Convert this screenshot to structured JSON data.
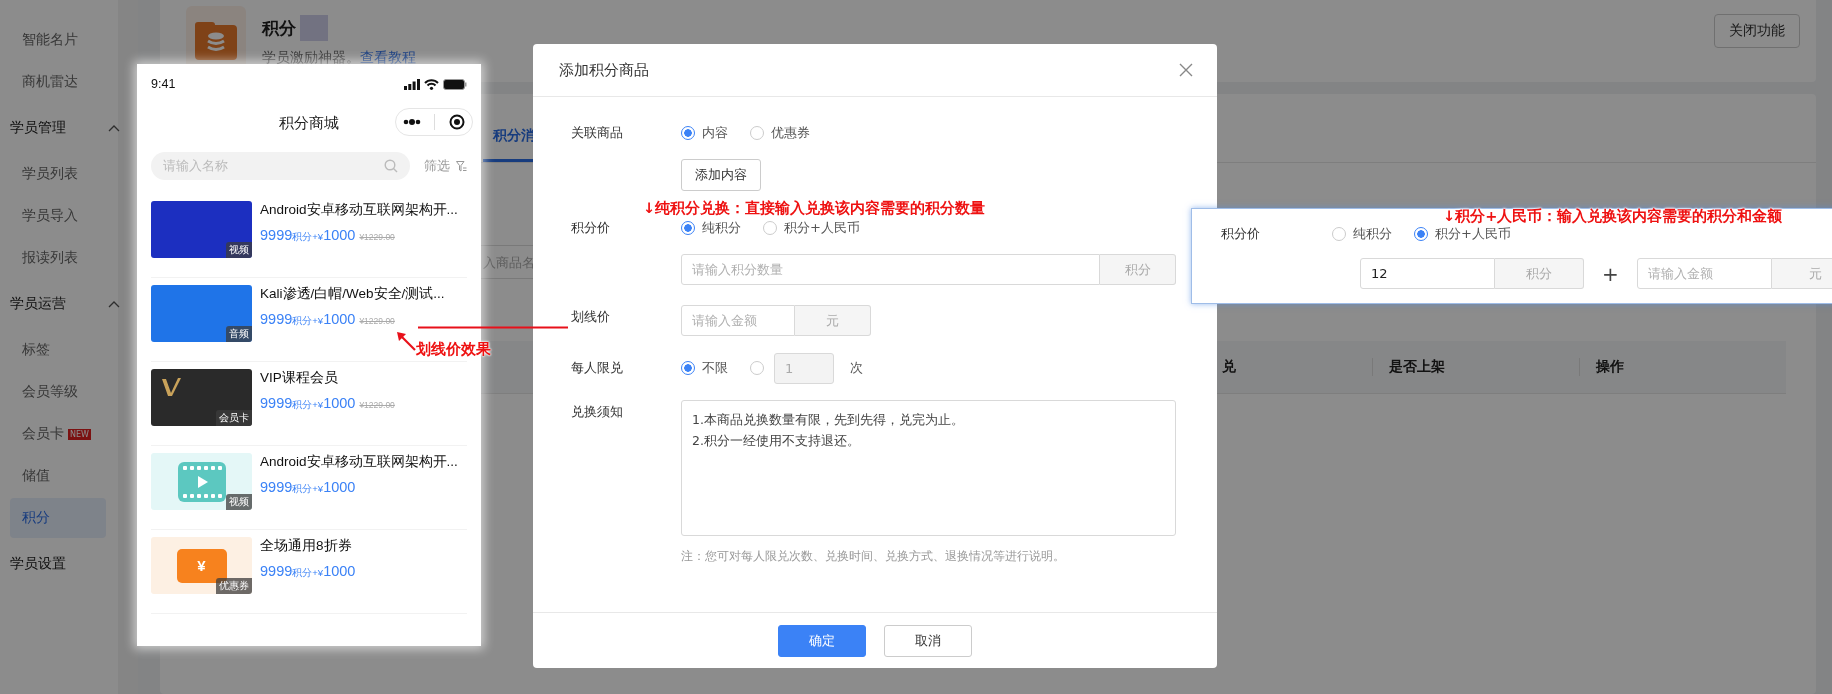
{
  "sidebar": {
    "items": [
      {
        "label": "智能名片",
        "kind": "item",
        "selected": false
      },
      {
        "label": "商机雷达",
        "kind": "item",
        "selected": false
      },
      {
        "label": "学员管理",
        "kind": "group",
        "expanded": true,
        "children": [
          {
            "label": "学员列表",
            "kind": "item",
            "selected": false
          },
          {
            "label": "学员导入",
            "kind": "item",
            "selected": false
          },
          {
            "label": "报读列表",
            "kind": "item",
            "selected": false
          }
        ]
      },
      {
        "label": "学员运营",
        "kind": "group",
        "expanded": true,
        "children": [
          {
            "label": "标签",
            "kind": "item",
            "selected": false
          },
          {
            "label": "会员等级",
            "kind": "item",
            "selected": false
          },
          {
            "label": "会员卡",
            "kind": "item",
            "selected": false,
            "badge": "NEW"
          },
          {
            "label": "储值",
            "kind": "item",
            "selected": false
          },
          {
            "label": "积分",
            "kind": "item",
            "selected": true
          }
        ]
      },
      {
        "label": "学员设置",
        "kind": "section"
      }
    ]
  },
  "header_card": {
    "title": "积分",
    "subtitle": "学员激励神器。",
    "link": "查看教程",
    "button": "关闭功能"
  },
  "tabs": [
    {
      "label": "积分消",
      "selected": true
    }
  ],
  "search": {
    "placeholder": "入商品名"
  },
  "table": {
    "columns": [
      "兑",
      "是否上架",
      "操作"
    ]
  },
  "phone": {
    "time": "9:41",
    "title": "积分商城",
    "search_placeholder": "请输入名称",
    "filter_label": "筛选",
    "products": [
      {
        "title": "Android安卓移动互联网架构开...",
        "thumb": {
          "kind": "photo",
          "color": "#1c2fc0",
          "badge": "视频"
        },
        "points": "9999",
        "unit": "积分+",
        "currency": "¥",
        "amount": "1000",
        "strike_price": "¥1229.00"
      },
      {
        "title": "Kali渗透/白帽/Web安全/测试...",
        "thumb": {
          "kind": "photo",
          "color": "#1f74e8",
          "badge": "音频"
        },
        "points": "9999",
        "unit": "积分+",
        "currency": "¥",
        "amount": "1000",
        "strike_price": "¥1229.00"
      },
      {
        "title": "VIP课程会员",
        "thumb": {
          "kind": "vip",
          "badge": "会员卡"
        },
        "points": "9999",
        "unit": "积分+",
        "currency": "¥",
        "amount": "1000",
        "strike_price": "¥1229.00"
      },
      {
        "title": "Android安卓移动互联网架构开...",
        "thumb": {
          "kind": "video",
          "badge": "视频"
        },
        "points": "9999",
        "unit": "积分+",
        "currency": "¥",
        "amount": "1000"
      },
      {
        "title": "全场通用8折券",
        "thumb": {
          "kind": "coupon",
          "badge": "优惠券",
          "icon_text": "¥"
        },
        "points": "9999",
        "unit": "积分+",
        "currency": "¥",
        "amount": "1000"
      }
    ]
  },
  "modal": {
    "title": "添加积分商品",
    "linked_goods": {
      "label": "关联商品",
      "options": [
        {
          "label": "内容",
          "selected": true
        },
        {
          "label": "优惠券",
          "selected": false
        }
      ],
      "add_button": "添加内容"
    },
    "points_price": {
      "label": "积分价",
      "options": [
        {
          "label": "纯积分",
          "selected": true
        },
        {
          "label": "积分+人民币",
          "selected": false
        }
      ],
      "placeholder": "请输入积分数量",
      "unit": "积分"
    },
    "strike_price": {
      "label": "划线价",
      "placeholder": "请输入金额",
      "unit": "元"
    },
    "limit": {
      "label": "每人限兑",
      "options": [
        {
          "label": "不限",
          "selected": true
        }
      ],
      "custom": {
        "selected": false,
        "value": "1",
        "unit": "次"
      }
    },
    "notice": {
      "label": "兑换须知",
      "value": "1.本商品兑换数量有限，先到先得，兑完为止。\n2.积分一经使用不支持退还。",
      "hint": "注：您可对每人限兑次数、兑换时间、兑换方式、退换情况等进行说明。"
    },
    "buttons": [
      {
        "label": "确定",
        "kind": "primary"
      },
      {
        "label": "取消",
        "kind": "default"
      }
    ]
  },
  "inset": {
    "label": "积分价",
    "options": [
      {
        "label": "纯积分",
        "selected": false
      },
      {
        "label": "积分+人民币",
        "selected": true
      }
    ],
    "points_value": "12",
    "points_unit": "积分",
    "plus": "+",
    "amount_placeholder": "请输入金额",
    "amount_unit": "元"
  },
  "annotations": [
    {
      "text": "↓纯积分兑换：直接输入兑换该内容需要的积分数量"
    },
    {
      "text": "↓积分+人民币：输入兑换该内容需要的积分和金额"
    },
    {
      "text": "划线价效果"
    }
  ]
}
